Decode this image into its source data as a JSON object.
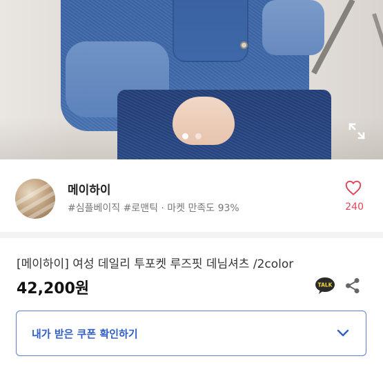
{
  "product_image": {
    "carousel_dots": 2,
    "active_dot": 0
  },
  "seller": {
    "name": "메이하이",
    "tags": "#심플베이직 #로맨틱 · 마켓 만족도 93%",
    "like_count": "240"
  },
  "product": {
    "title": "[메이하이] 여성 데일리 투포켓 루즈핏 데님셔츠 /2color",
    "price": "42,200원"
  },
  "actions": {
    "talk_badge": "TALK"
  },
  "coupon": {
    "label": "내가 받은 쿠폰 확인하기"
  },
  "colors": {
    "accent_blue": "#2f5ec9",
    "heart_red": "#e0465b",
    "denim": "#3f6aaa"
  },
  "icons": [
    "expand-icon",
    "heart-icon",
    "kakao-talk-icon",
    "share-icon",
    "chevron-down-icon"
  ]
}
